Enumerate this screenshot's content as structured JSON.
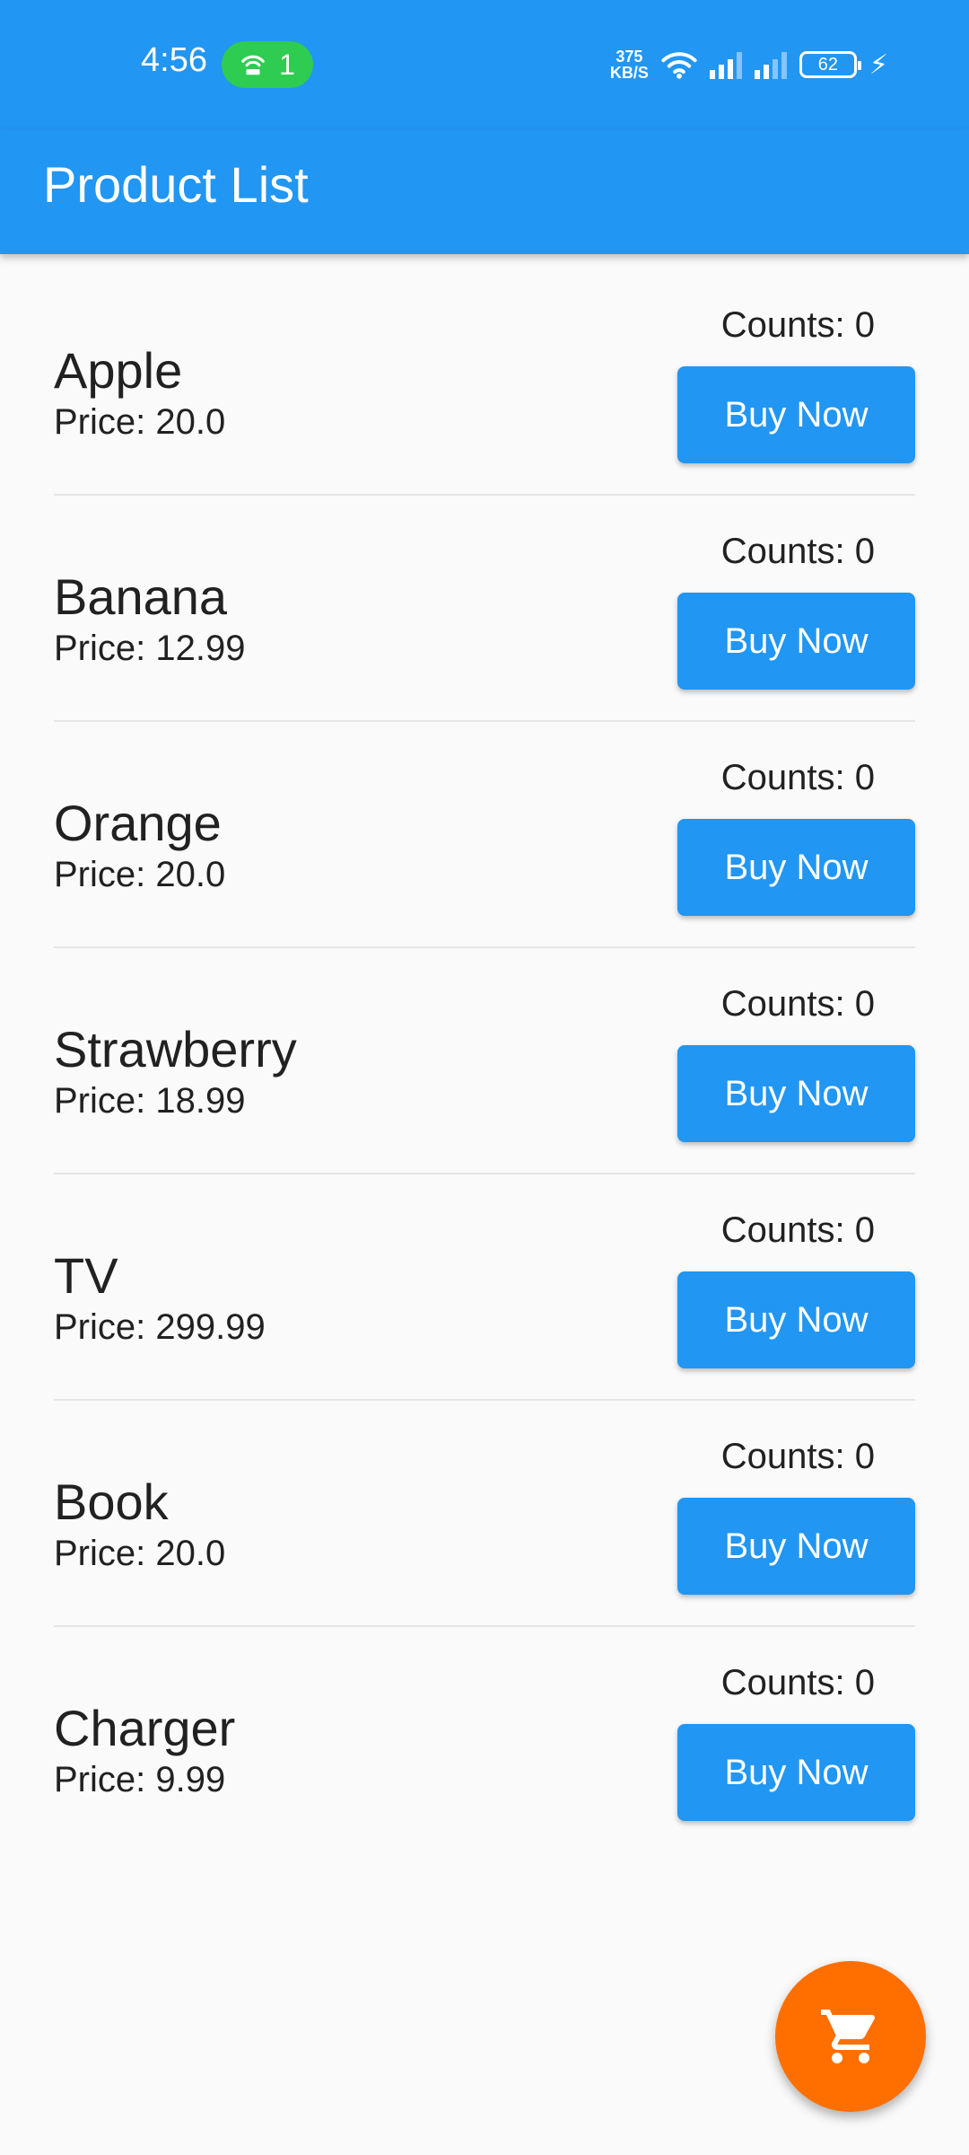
{
  "status_bar": {
    "time": "4:56",
    "hotspot_count": "1",
    "net_speed_value": "375",
    "net_speed_unit": "KB/S",
    "battery_level": "62"
  },
  "app_bar": {
    "title": "Product List"
  },
  "products": [
    {
      "name": "Apple",
      "price": "Price: 20.0",
      "count": "Counts: 0",
      "button": "Buy Now"
    },
    {
      "name": "Banana",
      "price": "Price: 12.99",
      "count": "Counts: 0",
      "button": "Buy Now"
    },
    {
      "name": "Orange",
      "price": "Price: 20.0",
      "count": "Counts: 0",
      "button": "Buy Now"
    },
    {
      "name": "Strawberry",
      "price": "Price: 18.99",
      "count": "Counts: 0",
      "button": "Buy Now"
    },
    {
      "name": "TV",
      "price": "Price: 299.99",
      "count": "Counts: 0",
      "button": "Buy Now"
    },
    {
      "name": "Book",
      "price": "Price: 20.0",
      "count": "Counts: 0",
      "button": "Buy Now"
    },
    {
      "name": "Charger",
      "price": "Price: 9.99",
      "count": "Counts: 0",
      "button": "Buy Now"
    }
  ],
  "fab": {
    "icon": "shopping-cart-icon",
    "color": "#ff6f00"
  },
  "colors": {
    "primary": "#2196f3",
    "accent": "#ff6f00",
    "hotspot": "#2ecc50"
  }
}
